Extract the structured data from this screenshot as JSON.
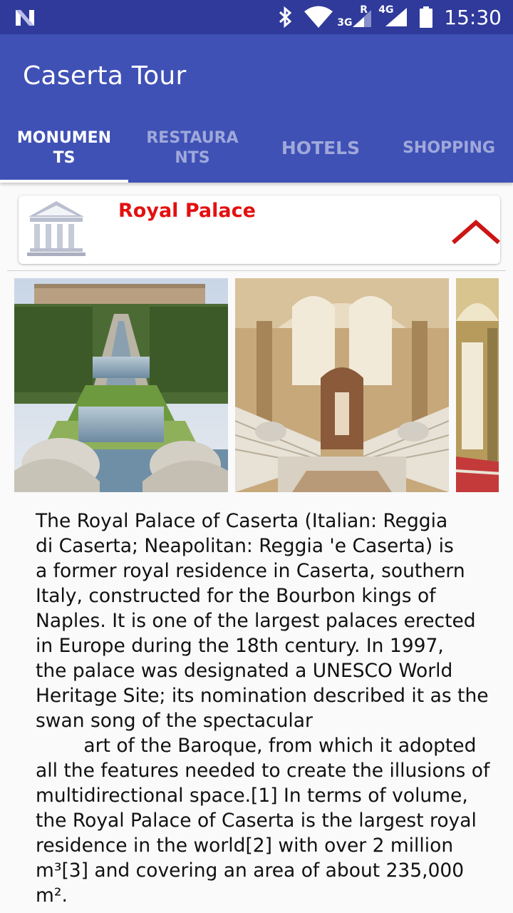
{
  "status_bar": {
    "time": "15:30",
    "icons": [
      "n-logo-icon",
      "bluetooth-icon",
      "wifi-icon",
      "signal-3g-icon",
      "signal-4g-icon",
      "battery-icon"
    ],
    "labels": {
      "net1": "3G",
      "roaming": "R",
      "net2": "4G"
    }
  },
  "app_bar": {
    "title": "Caserta Tour"
  },
  "tabs": [
    {
      "label": "MONUMENTS",
      "active": true
    },
    {
      "label": "RESTAURANTS",
      "active": false
    },
    {
      "label": "HOTELS",
      "active": false
    },
    {
      "label": "SHOPPING",
      "active": false
    }
  ],
  "card": {
    "title": "Royal Palace",
    "icon": "monument-icon",
    "expand_icon": "chevron-up-icon",
    "accent_color": "#e31010"
  },
  "gallery": {
    "images": [
      "palace-gardens-photo",
      "grand-staircase-photo",
      "palace-hall-photo"
    ]
  },
  "description": "The Royal Palace of Caserta (Italian: Reggia\ndi Caserta; Neapolitan: Reggia 'e Caserta) is\na former royal residence in Caserta, southern\nItaly, constructed for the Bourbon kings of\nNaples. It is one of the largest palaces erected\nin Europe during the 18th century. In 1997,\nthe palace was designated a UNESCO World\nHeritage Site; its nomination described it as the\nswan song of the spectacular\n        art of the Baroque, from which it adopted\nall the features needed to create the illusions of\nmultidirectional space.[1] In terms of volume,\nthe Royal Palace of Caserta is the largest royal\nresidence in the world[2] with over 2 million\nm³[3] and covering an area of about 235,000\nm².",
  "colors": {
    "primary": "#3f51b5",
    "primary_dark": "#2f3a9b",
    "accent": "#e31010"
  }
}
